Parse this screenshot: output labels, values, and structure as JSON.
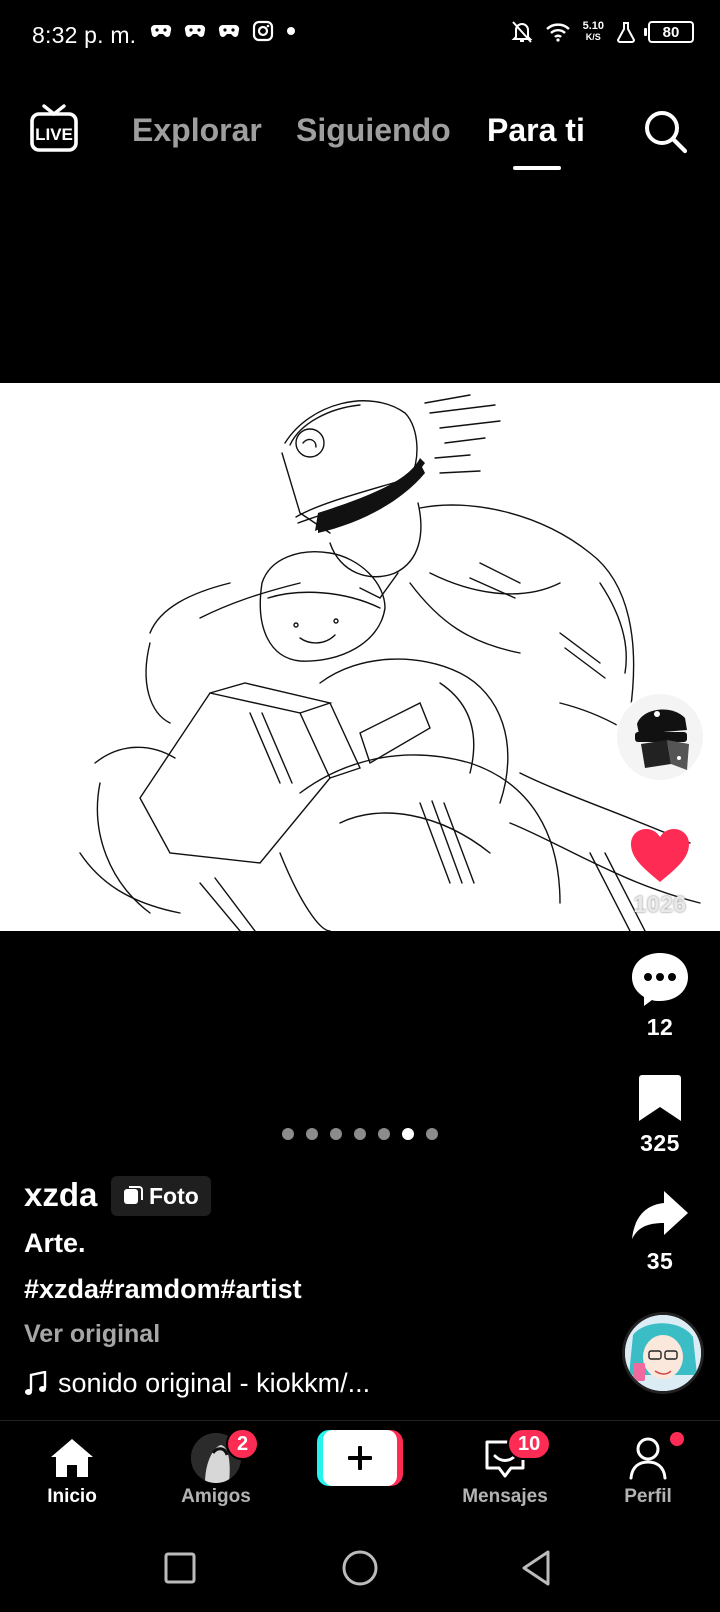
{
  "status_bar": {
    "time": "8:32 p. m.",
    "net_speed_value": "5.10",
    "net_speed_unit": "K/S",
    "battery": "80",
    "left_icons": [
      "game-controller-icon",
      "game-controller-icon",
      "game-controller-icon",
      "instagram-icon",
      "dot-icon"
    ],
    "right_icons": [
      "notifications-off-icon",
      "wifi-icon",
      "lab-flask-icon",
      "battery-icon"
    ]
  },
  "top_nav": {
    "live_label": "LIVE",
    "tabs": [
      {
        "label": "Explorar",
        "active": false
      },
      {
        "label": "Siguiendo",
        "active": false
      },
      {
        "label": "Para ti",
        "active": true
      }
    ]
  },
  "actions": {
    "likes": "1026",
    "comments": "12",
    "saves": "325",
    "shares": "35"
  },
  "carousel": {
    "total": 7,
    "active_index": 5
  },
  "caption": {
    "username": "xzda",
    "badge": "Foto",
    "title": "Arte.",
    "hashtags": "#xzda#ramdom#artist",
    "see_original": "Ver original",
    "sound": "sonido original - kiokkm/..."
  },
  "bottom_nav": {
    "items": [
      {
        "label": "Inicio",
        "active": true
      },
      {
        "label": "Amigos",
        "badge": "2"
      },
      {
        "label": "Mensajes",
        "badge": "10"
      },
      {
        "label": "Perfil"
      }
    ]
  },
  "colors": {
    "accent": "#fe2c55",
    "cyan": "#25f4ee",
    "background": "#000000"
  }
}
